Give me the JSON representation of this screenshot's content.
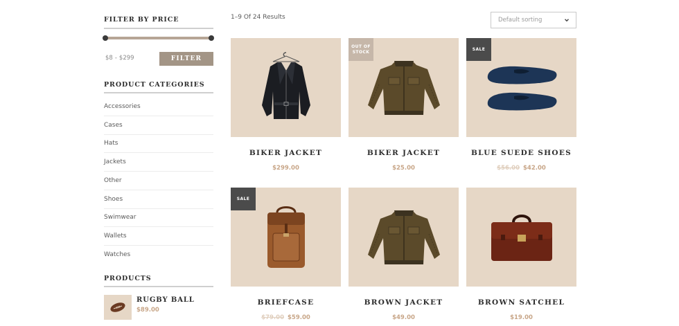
{
  "sidebar": {
    "price_filter": {
      "title": "FILTER BY PRICE",
      "min_label": "$8",
      "separator": "-",
      "max_label": "$299",
      "button_label": "FILTER"
    },
    "categories": {
      "title": "PRODUCT CATEGORIES",
      "items": [
        "Accessories",
        "Cases",
        "Hats",
        "Jackets",
        "Other",
        "Shoes",
        "Swimwear",
        "Wallets",
        "Watches"
      ]
    },
    "products": {
      "title": "PRODUCTS",
      "items": [
        {
          "name": "RUGBY BALL",
          "price": "$89.00",
          "icon": "rugby-ball-icon"
        }
      ]
    }
  },
  "main": {
    "results_text": "1–9 Of 24 Results",
    "sorting": {
      "selected": "Default sorting"
    },
    "products": [
      {
        "name": "BIKER JACKET",
        "price": "$299.00",
        "old_price": "",
        "badge": "",
        "icon": "leather-jacket-icon"
      },
      {
        "name": "BIKER JACKET",
        "price": "$25.00",
        "old_price": "",
        "badge": "OUT OF STOCK",
        "icon": "brown-jacket-icon"
      },
      {
        "name": "BLUE SUEDE SHOES",
        "price": "$42.00",
        "old_price": "$56.00",
        "badge": "SALE",
        "icon": "shoes-icon"
      },
      {
        "name": "BRIEFCASE",
        "price": "$59.00",
        "old_price": "$79.00",
        "badge": "SALE",
        "icon": "backpack-icon"
      },
      {
        "name": "BROWN JACKET",
        "price": "$49.00",
        "old_price": "",
        "badge": "",
        "icon": "brown-jacket-icon"
      },
      {
        "name": "BROWN SATCHEL",
        "price": "$19.00",
        "old_price": "",
        "badge": "",
        "icon": "satchel-icon"
      }
    ]
  },
  "colors": {
    "card_background": "#e6d7c6",
    "price": "#c8a688",
    "filter_button": "#a39586",
    "badge_dark": "#4b4b4b",
    "badge_light": "#c6b7a9"
  }
}
